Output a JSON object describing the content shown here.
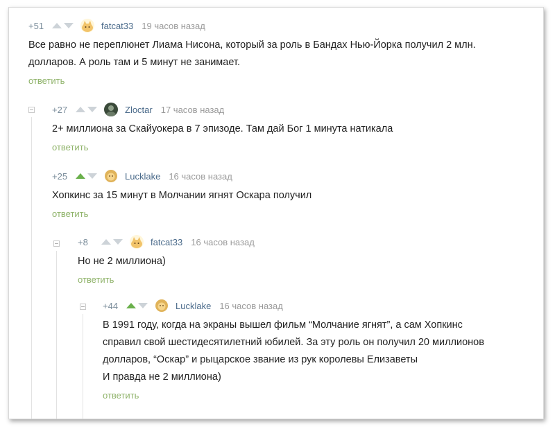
{
  "comments": [
    {
      "rating": "+51",
      "up_active": false,
      "author": "fatcat33",
      "time": "19 часов назад",
      "lines": [
        "Все равно не переплюнет Лиама Нисона, который за роль в Бандах Нью-Йорка получил 2 млн.",
        "долларов. А роль там и 5 минут не занимает."
      ],
      "reply": "ответить"
    },
    {
      "rating": "+27",
      "up_active": false,
      "author": "Zloctar",
      "time": "17 часов назад",
      "lines": [
        "2+ миллиона за Скайуокера в 7 эпизоде. Там дай Бог 1 минута натикала"
      ],
      "reply": "ответить"
    },
    {
      "rating": "+25",
      "up_active": true,
      "author": "Lucklake",
      "time": "16 часов назад",
      "lines": [
        "Хопкинс за 15 минут в Молчании ягнят Оскара получил"
      ],
      "reply": "ответить"
    },
    {
      "rating": "+8",
      "up_active": false,
      "author": "fatcat33",
      "time": "16 часов назад",
      "lines": [
        "Но не 2 миллиона)"
      ],
      "reply": "ответить"
    },
    {
      "rating": "+44",
      "up_active": true,
      "author": "Lucklake",
      "time": "16 часов назад",
      "lines": [
        "В 1991 году, когда на экраны вышел фильм “Молчание ягнят”, а сам Хопкинс",
        "справил свой шестидесятилетний юбилей. За эту роль он получил 20 миллионов",
        "долларов, “Оскар” и рыцарское звание из рук королевы Елизаветы",
        "И правда не 2 миллиона)"
      ],
      "reply": "ответить"
    }
  ],
  "colors": {
    "accent_reply": "#8fb36a",
    "author": "#4a6a8a",
    "upvote_active": "#6ab04c"
  }
}
